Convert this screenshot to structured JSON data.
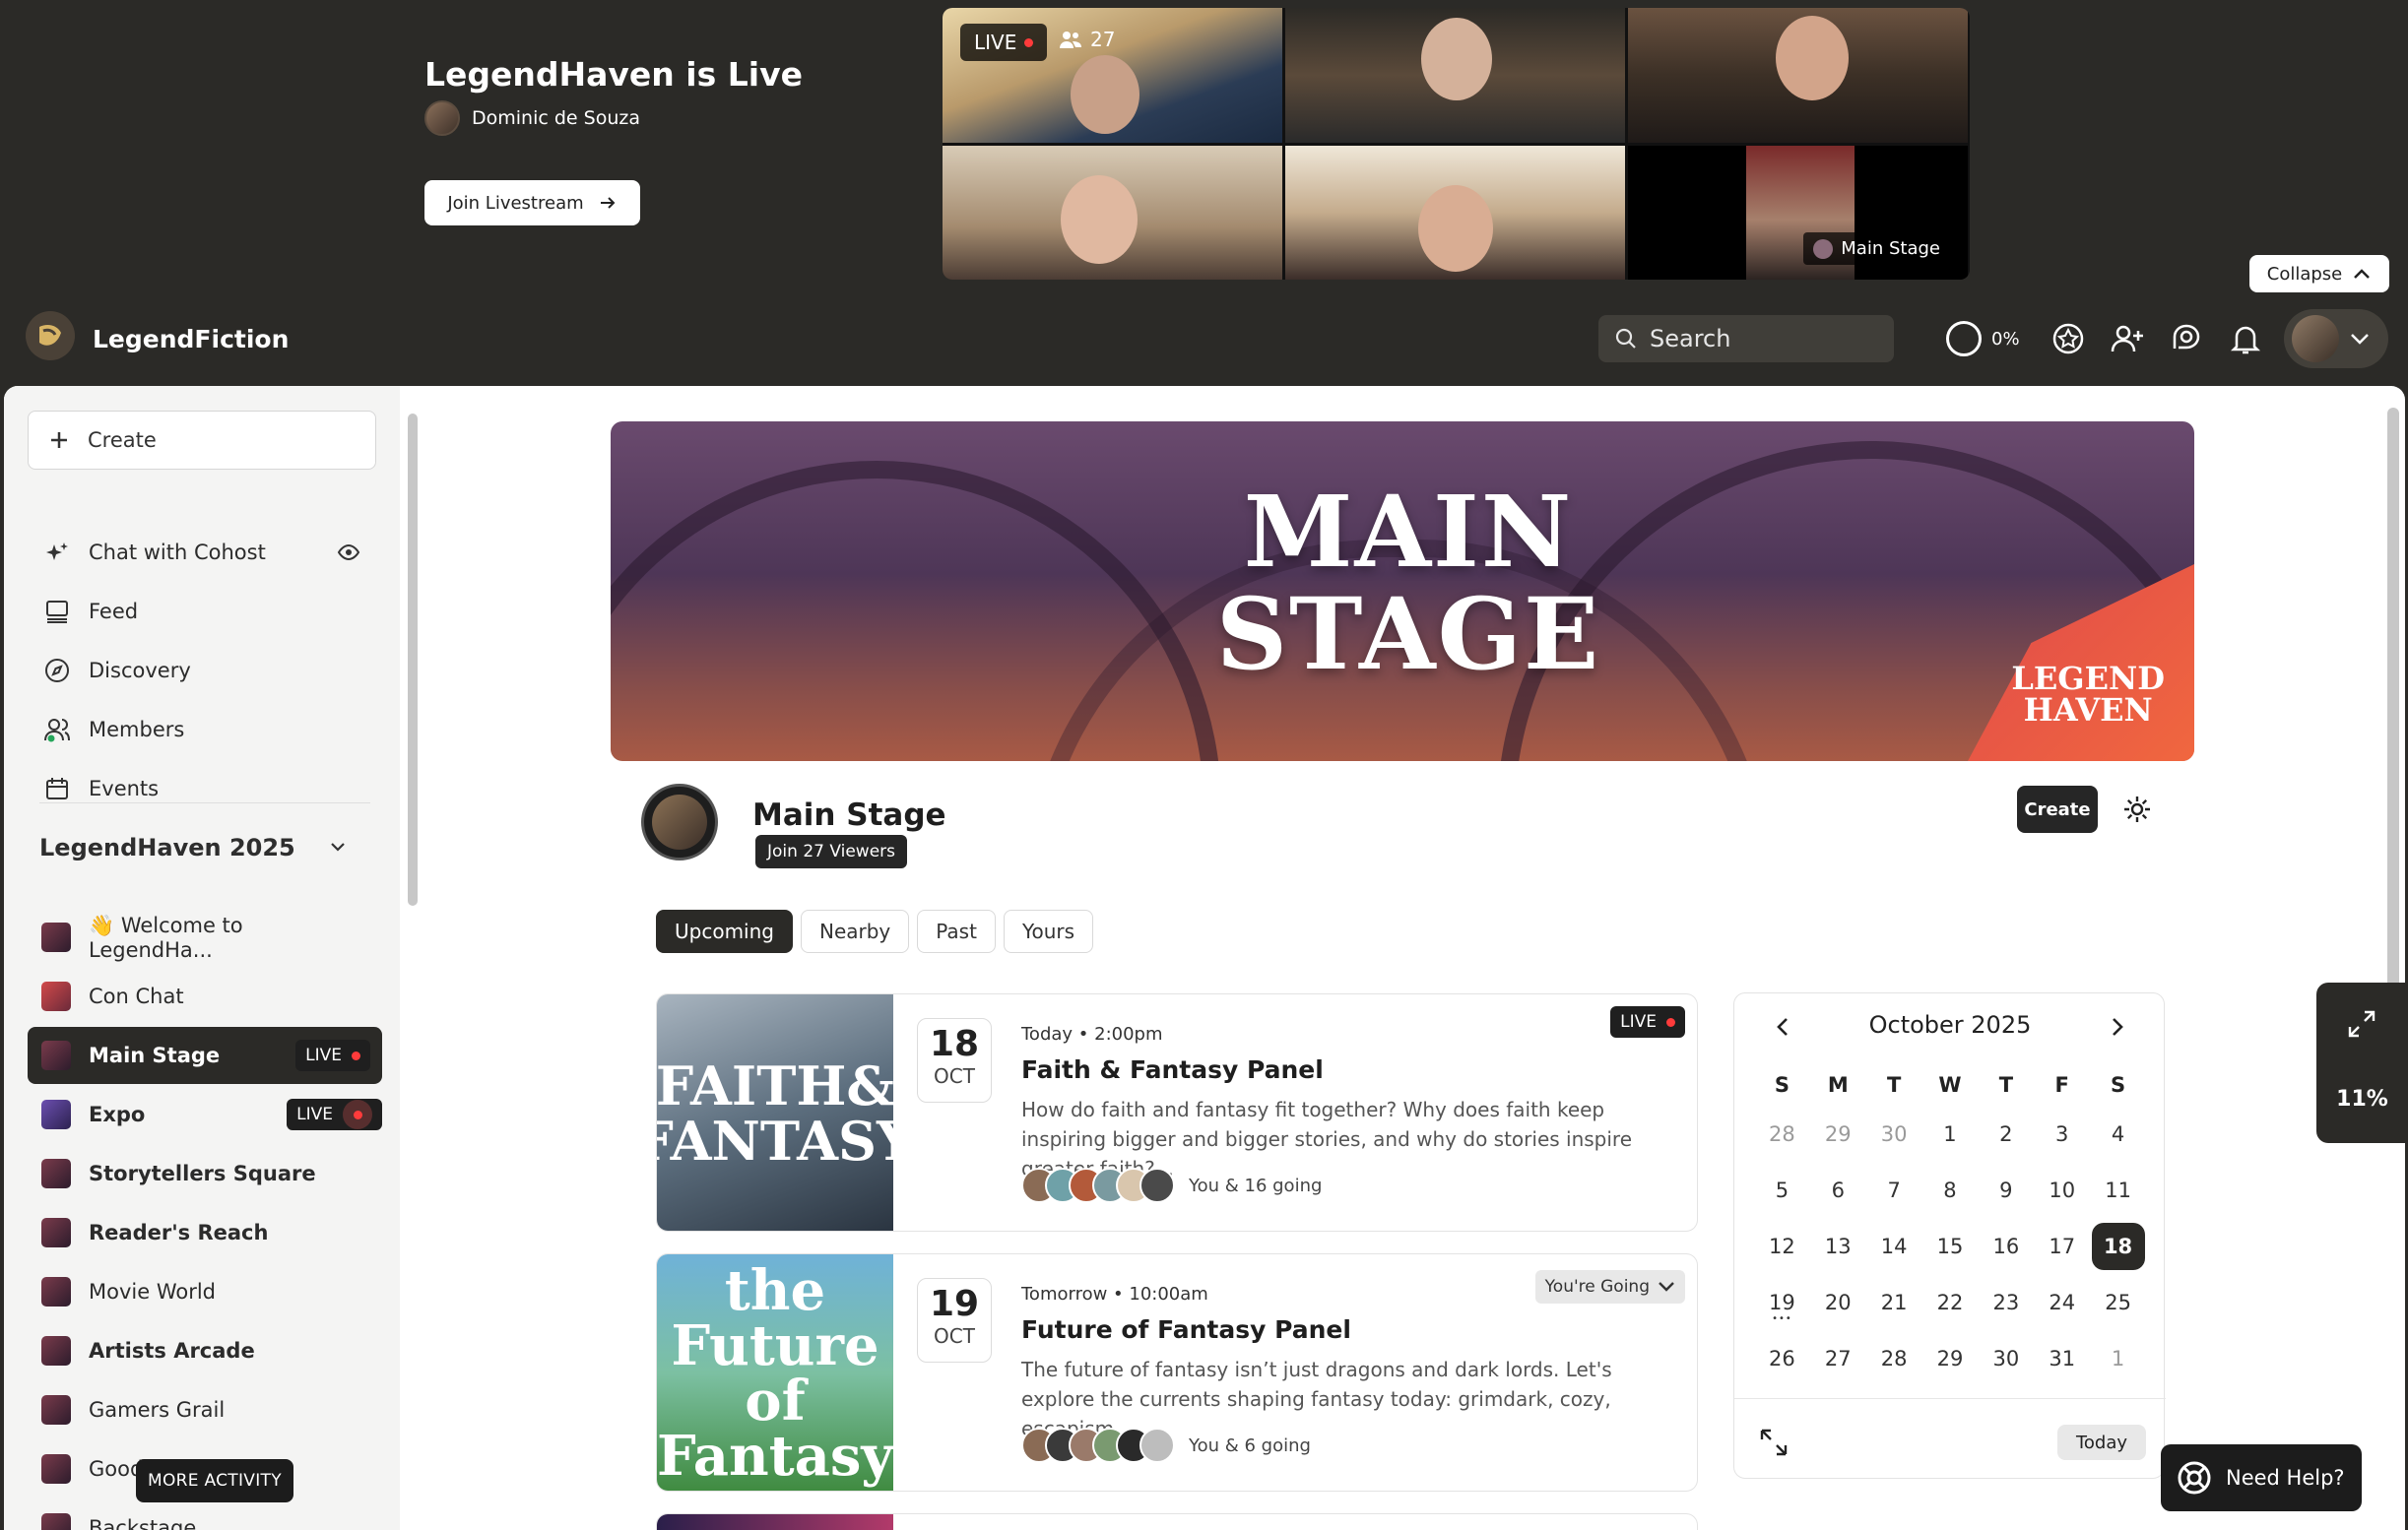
{
  "banner": {
    "title": "LegendHaven is Live",
    "host": "Dominic de Souza",
    "join_label": "Join Livestream",
    "live_label": "LIVE",
    "viewer_count": "27",
    "stage_label": "Main Stage",
    "collapse_label": "Collapse"
  },
  "navbar": {
    "brand": "LegendFiction",
    "search_placeholder": "Search",
    "progress": "0%",
    "icons": [
      "star-badge-icon",
      "add-user-icon",
      "chat-icon",
      "bell-icon"
    ]
  },
  "sidebar": {
    "create_label": "Create",
    "items": [
      {
        "label": "Chat with Cohost",
        "icon": "sparkle-icon"
      },
      {
        "label": "Feed",
        "icon": "feed-icon"
      },
      {
        "label": "Discovery",
        "icon": "compass-icon"
      },
      {
        "label": "Members",
        "icon": "members-icon"
      },
      {
        "label": "Events",
        "icon": "calendar-icon"
      }
    ],
    "section_title": "LegendHaven 2025",
    "channels": [
      {
        "label": "👋 Welcome to LegendHa..."
      },
      {
        "label": "Con Chat"
      },
      {
        "label": "Main Stage",
        "live": "LIVE"
      },
      {
        "label": "Expo",
        "live": "LIVE"
      },
      {
        "label": "Storytellers Square"
      },
      {
        "label": "Reader's Reach"
      },
      {
        "label": "Movie World"
      },
      {
        "label": "Artists Arcade"
      },
      {
        "label": "Gamers Grail"
      },
      {
        "label": "Goodie Bag"
      },
      {
        "label": "Backstage"
      }
    ],
    "more_activity": "MORE ACTIVITY"
  },
  "hero": {
    "title_line1": "MAIN",
    "title_line2": "STAGE",
    "corner_line1": "LEGEND",
    "corner_line2": "HAVEN"
  },
  "stage": {
    "name": "Main Stage",
    "join_viewers": "Join 27 Viewers",
    "create_label": "Create"
  },
  "tabs": [
    "Upcoming",
    "Nearby",
    "Past",
    "Yours"
  ],
  "events": [
    {
      "image_text_1": "FAITH&",
      "image_text_2": "FANTASY",
      "day": "18",
      "month": "OCT",
      "when": "Today • 2:00pm",
      "title": "Faith & Fantasy Panel",
      "desc": "How do faith and fantasy fit together? Why does faith keep inspiring bigger and bigger stories, and why do stories inspire greater faith?...",
      "going": "You & 16 going",
      "status": "LIVE"
    },
    {
      "image_text_1": "the Future",
      "image_text_2": "of Fantasy",
      "day": "19",
      "month": "OCT",
      "when": "Tomorrow • 10:00am",
      "title": "Future of Fantasy Panel",
      "desc": "The future of fantasy isn’t just dragons and dark lords. Let's explore the currents shaping fantasy today: grimdark, cozy, escapism,...",
      "going": "You & 6 going",
      "status": "You're Going"
    }
  ],
  "calendar": {
    "month": "October 2025",
    "weekdays": [
      "S",
      "M",
      "T",
      "W",
      "T",
      "F",
      "S"
    ],
    "days": [
      "28",
      "29",
      "30",
      "1",
      "2",
      "3",
      "4",
      "5",
      "6",
      "7",
      "8",
      "9",
      "10",
      "11",
      "12",
      "13",
      "14",
      "15",
      "16",
      "17",
      "18",
      "19",
      "20",
      "21",
      "22",
      "23",
      "24",
      "25",
      "26",
      "27",
      "28",
      "29",
      "30",
      "31",
      "1"
    ],
    "today_label": "Today"
  },
  "widget": {
    "percent": "11%"
  },
  "help": {
    "label": "Need Help?"
  }
}
